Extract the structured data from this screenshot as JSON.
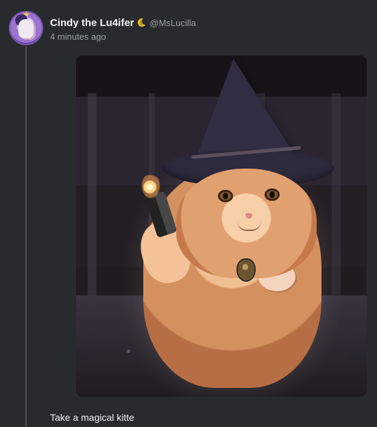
{
  "post": {
    "display_name": "Cindy the Lu4ifer",
    "handle": "@MsLucilla",
    "timestamp": "4 minutes ago",
    "text": "Take a magical kitte",
    "icons": {
      "display_name_badge": "crescent-moon-icon"
    },
    "colors": {
      "background": "#282b2d",
      "text": "#f4f4f4",
      "muted": "#9aa1a6",
      "moon": "#f5c623"
    }
  }
}
